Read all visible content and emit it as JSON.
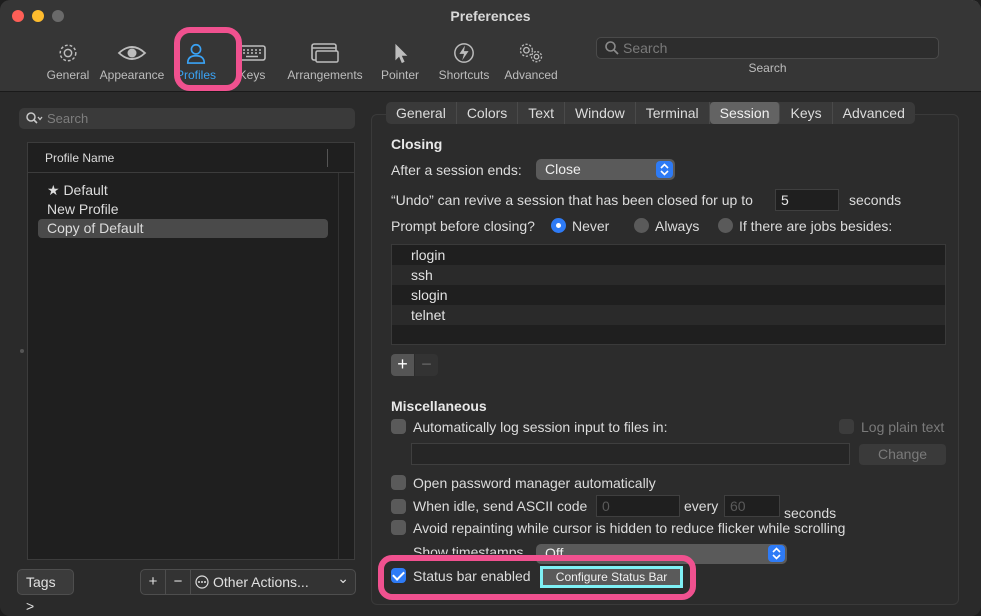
{
  "window": {
    "title": "Preferences"
  },
  "colors": {
    "accent": "#2e7bf6",
    "highlight_ring": "#f0518f",
    "highlight_box": "#7ef0f5"
  },
  "toolbar": {
    "items": [
      {
        "label": "General",
        "icon": "gear-icon"
      },
      {
        "label": "Appearance",
        "icon": "eye-icon"
      },
      {
        "label": "Profiles",
        "icon": "person-icon"
      },
      {
        "label": "Keys",
        "icon": "keyboard-icon"
      },
      {
        "label": "Arrangements",
        "icon": "windows-icon"
      },
      {
        "label": "Pointer",
        "icon": "pointer-icon"
      },
      {
        "label": "Shortcuts",
        "icon": "lightning-icon"
      },
      {
        "label": "Advanced",
        "icon": "gears-icon"
      }
    ],
    "search_placeholder": "Search",
    "search_caption": "Search"
  },
  "profiles": {
    "search_placeholder": "Search",
    "column_header": "Profile Name",
    "rows": [
      "★ Default",
      "New Profile",
      "Copy of Default"
    ],
    "selected_index": 2,
    "tags_button": "Tags >",
    "add": "+",
    "remove": "−",
    "other_actions": "Other Actions...",
    "other_actions_chevron": "⌄"
  },
  "tabs": [
    "General",
    "Colors",
    "Text",
    "Window",
    "Terminal",
    "Session",
    "Keys",
    "Advanced"
  ],
  "active_tab": "Session",
  "closing": {
    "heading": "Closing",
    "after_session_label": "After a session ends:",
    "after_session_value": "Close",
    "undo_label": "“Undo” can revive a session that has been closed for up to",
    "undo_value": "5",
    "undo_unit": "seconds",
    "prompt_label": "Prompt before closing?",
    "radio_never": "Never",
    "radio_always": "Always",
    "radio_jobs": "If there are jobs besides:",
    "selected_radio": "Never",
    "jobs": [
      "rlogin",
      "ssh",
      "slogin",
      "telnet"
    ],
    "add": "+",
    "remove": "−"
  },
  "misc": {
    "heading": "Miscellaneous",
    "auto_log_label": "Automatically log session input to files in:",
    "log_plain_text": "Log plain text",
    "change_button": "Change",
    "open_password": "Open password manager automatically",
    "idle_label": "When idle, send ASCII code",
    "idle_code": "0",
    "every_label": "every",
    "every_value": "60",
    "every_unit": "seconds",
    "avoid_repaint": "Avoid repainting while cursor is hidden to reduce flicker while scrolling",
    "show_timestamps": "Show timestamps",
    "timestamps_value": "Off",
    "status_bar_label": "Status bar enabled",
    "status_bar_checked": true,
    "configure_button": "Configure Status Bar"
  }
}
